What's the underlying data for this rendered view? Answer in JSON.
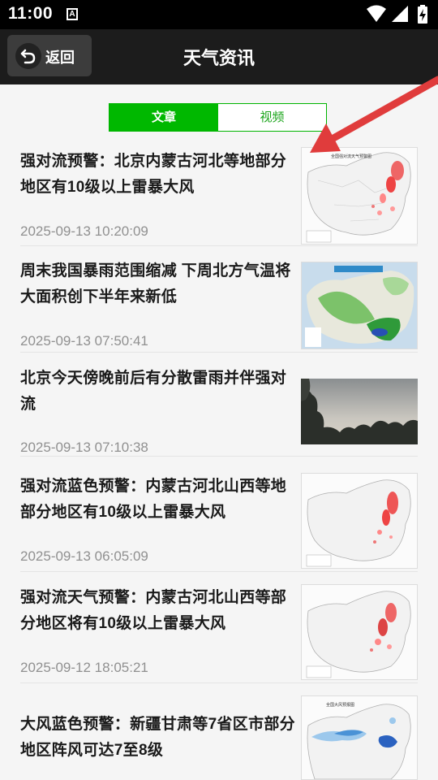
{
  "status_bar": {
    "time": "11:00",
    "icons": [
      "a-notification-icon",
      "wifi-icon",
      "signal-icon",
      "battery-charging-icon"
    ]
  },
  "header": {
    "back_label": "返回",
    "title": "天气资讯"
  },
  "tabs": [
    {
      "label": "文章",
      "active": true
    },
    {
      "label": "视频",
      "active": false
    }
  ],
  "articles": [
    {
      "title": "强对流预警：北京内蒙古河北等地部分地区有10级以上雷暴大风",
      "time": "2025-09-13 10:20:09",
      "thumb": "warning-map"
    },
    {
      "title": "周末我国暴雨范围缩减 下周北方气温将大面积创下半年来新低",
      "time": "2025-09-13 07:50:41",
      "thumb": "rain-map"
    },
    {
      "title": "北京今天傍晚前后有分散雷雨并伴强对流",
      "time": "2025-09-13 07:10:38",
      "thumb": "sky-photo"
    },
    {
      "title": "强对流蓝色预警：内蒙古河北山西等地部分地区有10级以上雷暴大风",
      "time": "2025-09-13 06:05:09",
      "thumb": "warning-map"
    },
    {
      "title": "强对流天气预警：内蒙古河北山西等部分地区将有10级以上雷暴大风",
      "time": "2025-09-12 18:05:21",
      "thumb": "warning-map"
    },
    {
      "title": "大风蓝色预警：新疆甘肃等7省区市部分地区阵风可达7至8级",
      "time": "",
      "thumb": "wind-map"
    }
  ],
  "colors": {
    "accent": "#00b800",
    "header_bg": "#1c1c1c",
    "arrow": "#e03c3c"
  }
}
